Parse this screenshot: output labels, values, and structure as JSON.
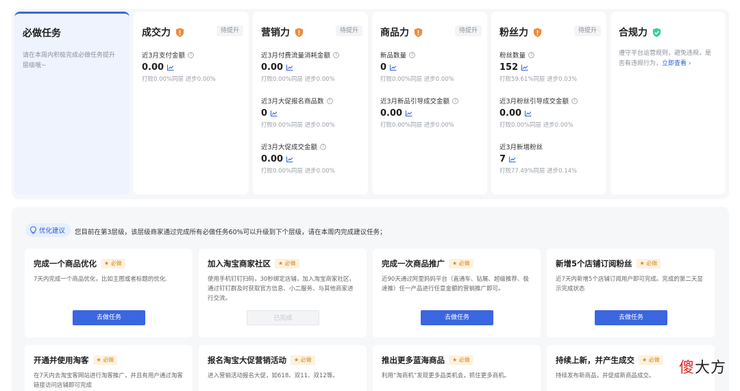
{
  "must_card": {
    "title": "必做任务",
    "desc": "请在本周内积极完成必做任务提升层级哦~"
  },
  "cards": [
    {
      "title": "成交力",
      "pill": "待提升",
      "metrics": [
        {
          "label": "近3月支付金额",
          "value": "0.00",
          "sub": "打败0.00%同层 进步0.00%"
        }
      ]
    },
    {
      "title": "营销力",
      "pill": "待提升",
      "metrics": [
        {
          "label": "近3月付费流量消耗金额",
          "value": "0.00",
          "sub": "打败0.00%同层 进步0.00%"
        },
        {
          "label": "近3月大促报名商品数",
          "value": "0",
          "sub": "打败0.00%同层 进步0.00%"
        },
        {
          "label": "近3月大促成交金额",
          "value": "0.00",
          "sub": "打败0.00%同层 进步0.00%"
        }
      ]
    },
    {
      "title": "商品力",
      "pill": "待提升",
      "metrics": [
        {
          "label": "新品数量",
          "value": "0",
          "sub": "打败0.00%同层 进步0.00%"
        },
        {
          "label": "近3月新品引导成交金额",
          "value": "0.00",
          "sub": "打败0.00%同层 进步0.00%"
        }
      ]
    },
    {
      "title": "粉丝力",
      "pill": "待提升",
      "metrics": [
        {
          "label": "粉丝数量",
          "value": "152",
          "sub": "打败59.61%同层 进步0.03%"
        },
        {
          "label": "近3月粉丝引导成交金额",
          "value": "0.00",
          "sub": "打败0.00%同层 进步0.00%"
        },
        {
          "label": "近3月新增粉丝",
          "value": "7",
          "sub": "打败77.49%同层 进步0.14%"
        }
      ]
    }
  ],
  "compliance": {
    "title": "合规力",
    "desc": "遵守平台运营规则，避免违规，是否有违规行为，",
    "link": "立即查看 ›"
  },
  "suggestion": {
    "badge": "优化建议",
    "text": "您目前在第3层级，该层级商家通过完成所有必做任务60%可以升级到下个层级，请在本周内完成建议任务；"
  },
  "tasks": [
    {
      "title": "完成一个商品优化",
      "tag": "★ 必做",
      "desc": "7天内完成一个商品优化，比如主图或者标题的优化.",
      "button": "去做任务",
      "disabled": false
    },
    {
      "title": "加入淘宝商家社区",
      "tag": "★ 必做",
      "desc": "使用手机钉钉扫码，30秒绑定店铺，加入淘宝商家社区，通过钉钉群及时获取官方信息、小二服务、与其他商家进行交流。",
      "button": "已完成",
      "disabled": true
    },
    {
      "title": "完成一次商品推广",
      "tag": "★ 必做",
      "desc": "近90天通过阿里妈妈平台（直通车、钻展、超级推荐、极速推）任一产品进行任意金额的营销推广即可。",
      "button": "去做任务",
      "disabled": false
    },
    {
      "title": "新增5个店铺订阅粉丝",
      "tag": "★ 必做",
      "desc": "近7天内新增5个店铺订阅用户即可完成。完成的第二天显示完成状态",
      "button": "去做任务",
      "disabled": false
    },
    {
      "title": "开通并使用淘客",
      "tag": "★ 必做",
      "desc": "在7天内去淘宝客网站进行淘客推广，并且有用户通过淘客链接访问店铺即可完成"
    },
    {
      "title": "报名淘宝大促营销活动",
      "tag": "★ 必做",
      "desc": "进入营销活动报名大促，如618、双11、双12等。"
    },
    {
      "title": "推出更多蓝海商品",
      "tag": "★ 必做",
      "desc": "利用“淘商机”发现更多品类机会，抓住更多商机。"
    },
    {
      "title": "持续上新，并产生成交",
      "tag": "★ 必做",
      "desc": "持续发布新商品，并促成新商品成交。"
    }
  ],
  "watermark": {
    "red": "傻",
    "black": "大方"
  },
  "colors": {
    "accent": "#3a66df",
    "warning_shield": "#f08a3c",
    "ok_shield": "#3ecf9e",
    "must_tag": "#d68a1d"
  }
}
